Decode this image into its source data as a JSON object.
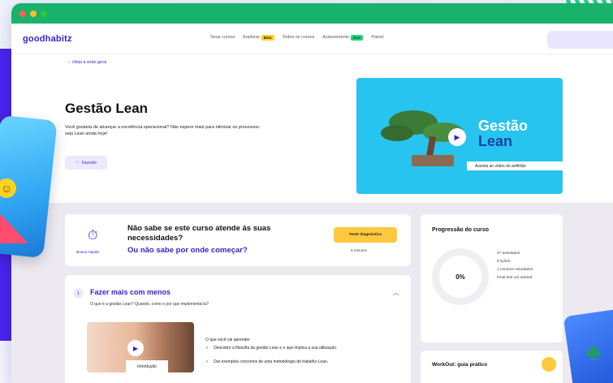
{
  "app": {
    "logo": "goodhabitz"
  },
  "nav": {
    "items": [
      "Seus cursos",
      "Explorar",
      "Todos os cursos",
      "Assessments",
      "Painel"
    ],
    "explorar_badge": "Beta",
    "assessments_badge": "New"
  },
  "hero": {
    "back_link": "Voltar à visão geral",
    "title": "Gestão Lean",
    "description": "Você gostaria de alcançar a excelência operacional? Não espere mais para otimizar os processos: seja Lean ainda hoje!",
    "favorite_label": "Favorito"
  },
  "video": {
    "title_line1": "Gestão",
    "title_line2": "Lean",
    "caption": "Assista ao vídeo do anfitrião"
  },
  "quick": {
    "label": "Busca rápida",
    "question_line1": "Não sabe se este curso atende às suas necessidades?",
    "question_line2": "Ou não sabe por onde começar?",
    "button": "Teste diagnóstico",
    "duration": "5 minutos"
  },
  "progress": {
    "title": "Progressão do curso",
    "percent": "0%",
    "percent_value": 0,
    "activities": "27 atividades",
    "lessons": "5 lições",
    "minutes": "1 minutos estudados",
    "final_test": "Final test not started"
  },
  "lesson": {
    "number": "1",
    "title": "Fazer mais com menos",
    "subtitle": "O que é a gestão Lean? Quando, como e por que implementá-la?",
    "thumb_label": "Introdução",
    "learn_heading": "O que você vai aprender",
    "learn_items": [
      "Descobrir a filosofia da gestão Lean e o que implica a sua utilização.",
      "Dar exemplos concretos de uma metodologia de trabalho Lean."
    ]
  },
  "workout": {
    "title": "WorkOut: guia prático"
  },
  "colors": {
    "brand": "#3a1fc9",
    "green": "#19b26b",
    "yellow": "#ffc93d",
    "video_bg": "#27c4f0"
  }
}
